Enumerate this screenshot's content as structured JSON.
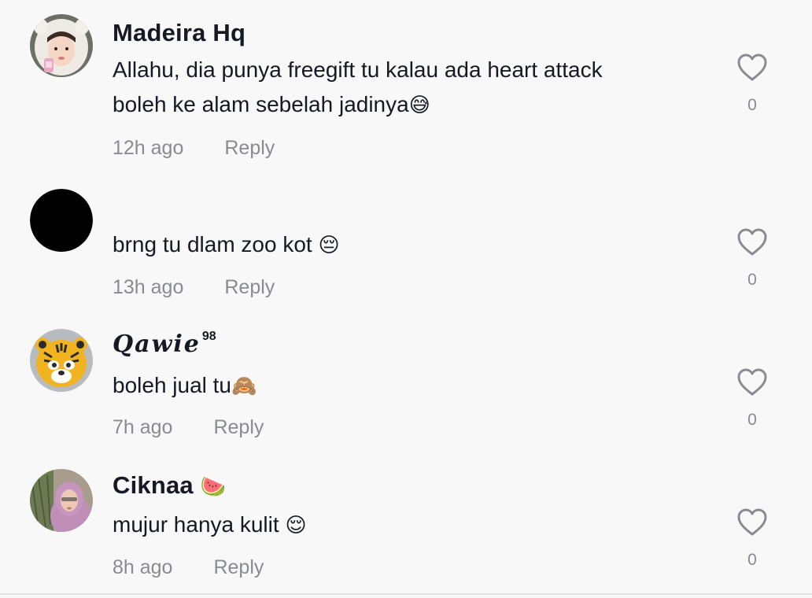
{
  "comments": [
    {
      "avatar_icon": "avatar-girl-white-hood",
      "username": "Madeira Hq",
      "text_line1": "Allahu, dia punya freegift tu kalau ada heart attack",
      "text_line2": "boleh ke alam sebelah jadinya",
      "emoji": "😅",
      "time": "12h ago",
      "reply": "Reply",
      "likes": "0"
    },
    {
      "avatar_icon": "avatar-black-circle",
      "username": "",
      "text": "brng tu dlam zoo kot",
      "emoji": "😔",
      "time": "13h ago",
      "reply": "Reply",
      "likes": "0"
    },
    {
      "avatar_icon": "avatar-tiger",
      "username": "Qawie",
      "username_sup": "98",
      "text": "boleh jual tu",
      "emoji": "🙈",
      "time": "7h ago",
      "reply": "Reply",
      "likes": "0"
    },
    {
      "avatar_icon": "avatar-hijab-girl",
      "username": "Ciknaa",
      "username_emoji": "🍉",
      "text": "mujur hanya kulit",
      "emoji": "😌",
      "time": "8h ago",
      "reply": "Reply",
      "likes": "0"
    }
  ],
  "colors": {
    "background": "#f8f8f8",
    "text": "#161823",
    "meta": "#8a8b91",
    "heart_outline": "#8a8b91"
  },
  "icons": {
    "like": "heart-outline-icon"
  }
}
